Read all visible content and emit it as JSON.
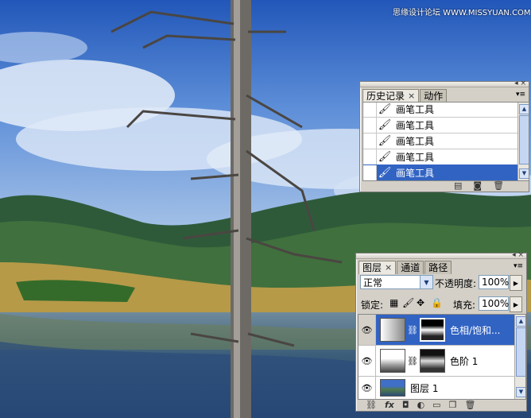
{
  "watermark": "思缘设计论坛 WWW.MISSYUAN.COM",
  "history_panel": {
    "tabs": [
      {
        "label": "历史记录",
        "active": true
      },
      {
        "label": "动作",
        "active": false
      }
    ],
    "items": [
      {
        "label": "画笔工具",
        "selected": false
      },
      {
        "label": "画笔工具",
        "selected": false
      },
      {
        "label": "画笔工具",
        "selected": false
      },
      {
        "label": "画笔工具",
        "selected": false
      },
      {
        "label": "画笔工具",
        "selected": true
      }
    ]
  },
  "layers_panel": {
    "tabs": [
      {
        "label": "图层",
        "active": true
      },
      {
        "label": "通道",
        "active": false
      },
      {
        "label": "路径",
        "active": false
      }
    ],
    "blend_mode": "正常",
    "opacity_label": "不透明度:",
    "opacity_value": "100%",
    "lock_label": "锁定:",
    "fill_label": "填充:",
    "fill_value": "100%",
    "layers": [
      {
        "name": "色相/饱和...",
        "selected": true
      },
      {
        "name": "色阶 1",
        "selected": false
      },
      {
        "name": "图层 1",
        "selected": false
      }
    ],
    "footer_fx": "fx"
  },
  "colors": {
    "selection": "#3163c3",
    "panel_bg": "#d4d0c8"
  }
}
